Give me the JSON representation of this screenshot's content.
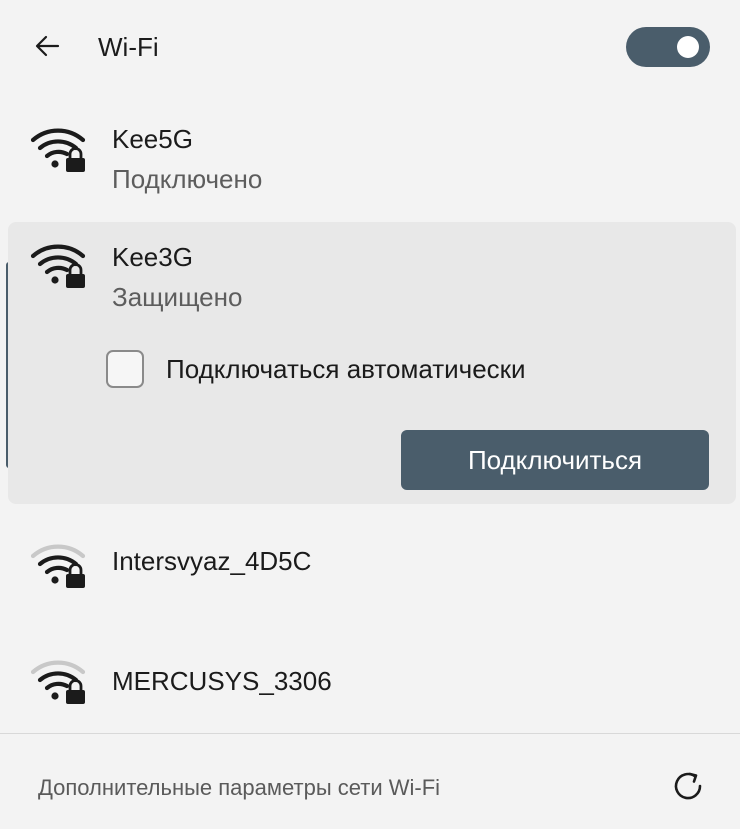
{
  "header": {
    "title": "Wi-Fi",
    "back_icon": "arrow-left-icon",
    "toggle_state": "on"
  },
  "networks": [
    {
      "name": "Kee5G",
      "status": "Подключено",
      "signal_bars": 4,
      "secured": true
    },
    {
      "name": "Kee3G",
      "status": "Защищено",
      "signal_bars": 4,
      "secured": true,
      "auto_connect_label": "Подключаться автоматически",
      "auto_connect_checked": false,
      "connect_label": "Подключиться"
    },
    {
      "name": "Intersvyaz_4D5C",
      "signal_bars": 3,
      "secured": true
    },
    {
      "name": "MERCUSYS_3306",
      "signal_bars": 3,
      "secured": true
    }
  ],
  "footer": {
    "link_label": "Дополнительные параметры сети Wi-Fi",
    "refresh_icon": "refresh-icon"
  },
  "colors": {
    "accent": "#4a5d6b",
    "background": "#f3f3f3",
    "selected_background": "#e8e8e8",
    "secondary_text": "#5d5d5d"
  }
}
